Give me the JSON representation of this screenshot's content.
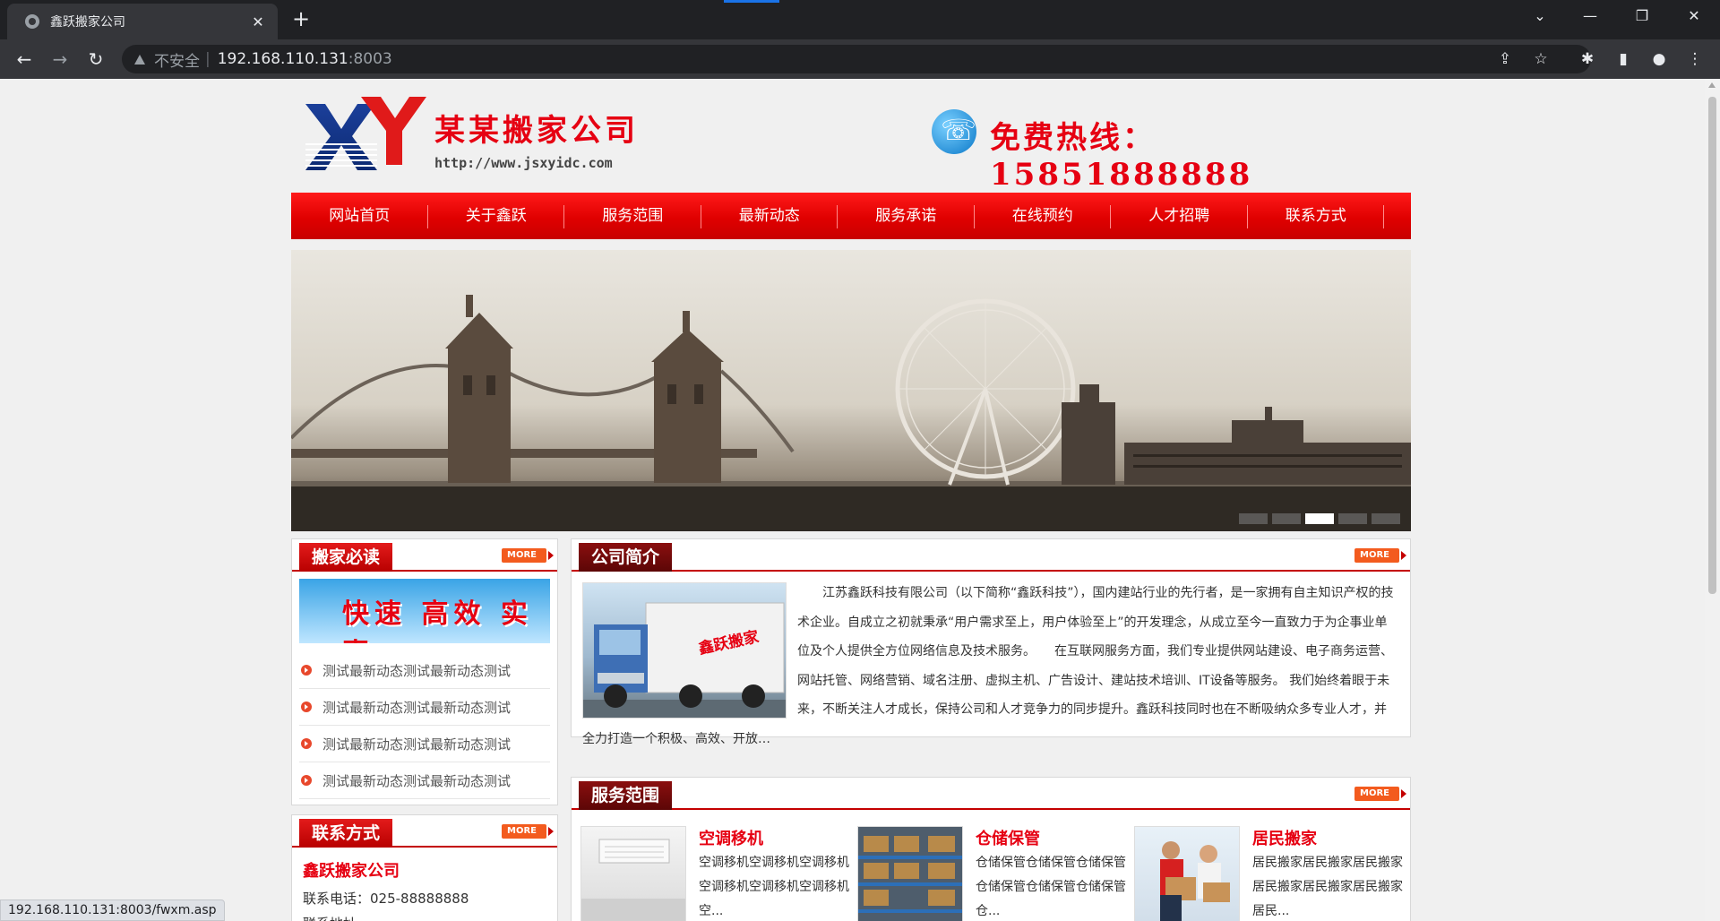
{
  "browser": {
    "tab_title": "鑫跃搬家公司",
    "insecure_label": "不安全",
    "url_host": "192.168.110.131",
    "url_port": ":8003",
    "status_url": "192.168.110.131:8003/fwxm.asp"
  },
  "header": {
    "company_name": "某某搬家公司",
    "company_url": "http://www.jsxyidc.com",
    "hotline": "免费热线：15851888888"
  },
  "nav": {
    "items": [
      "网站首页",
      "关于鑫跃",
      "服务范围",
      "最新动态",
      "服务承诺",
      "在线预约",
      "人才招聘",
      "联系方式"
    ]
  },
  "banner": {
    "slides": 5,
    "active_slide": 3
  },
  "common": {
    "more_label": "MORE"
  },
  "must_read": {
    "title": "搬家必读",
    "promo_text": "快速 高效 实惠",
    "items": [
      "测试最新动态测试最新动态测试",
      "测试最新动态测试最新动态测试",
      "测试最新动态测试最新动态测试",
      "测试最新动态测试最新动态测试"
    ]
  },
  "contact": {
    "title": "联系方式",
    "company": "鑫跃搬家公司",
    "phone": "联系电话：025-88888888",
    "extra": "联系地址"
  },
  "about": {
    "title": "公司简介",
    "image_caption": "鑫跃搬家",
    "text": "　　江苏鑫跃科技有限公司（以下简称“鑫跃科技”），国内建站行业的先行者，是一家拥有自主知识产权的技术企业。自成立之初就秉承“用户需求至上，用户体验至上”的开发理念，从成立至今一直致力于为企事业单位及个人提供全方位网络信息及技术服务。　　在互联网服务方面，我们专业提供网站建设、电子商务运营、网站托管、网络营销、域名注册、虚拟主机、广告设计、建站技术培训、IT设备等服务。 我们始终着眼于未来，不断关注人才成长，保持公司和人才竞争力的同步提升。鑫跃科技同时也在不断吸纳众多专业人才，并全力打造一个积极、高效、开放…"
  },
  "services": {
    "title": "服务范围",
    "items": [
      {
        "title": "空调移机",
        "desc": "空调移机空调移机空调移机空调移机空调移机空调移机空..."
      },
      {
        "title": "仓储保管",
        "desc": "仓储保管仓储保管仓储保管仓储保管仓储保管仓储保管仓..."
      },
      {
        "title": "居民搬家",
        "desc": "居民搬家居民搬家居民搬家居民搬家居民搬家居民搬家居民..."
      }
    ]
  },
  "colors": {
    "brand_red": "#e60012",
    "nav_red": "#e00000",
    "accent_blue": "#1a73e8"
  }
}
